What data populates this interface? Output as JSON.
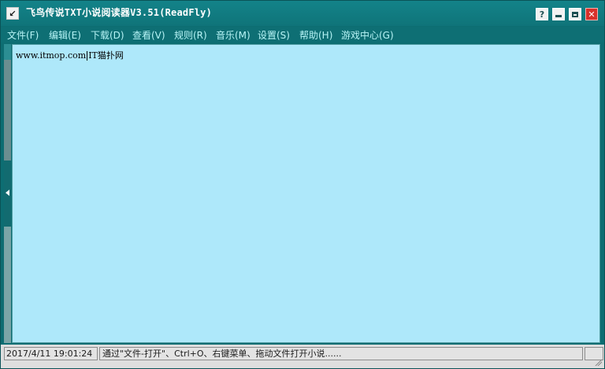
{
  "window": {
    "title": "飞鸟传说TXT小说阅读器V3.51(ReadFly)",
    "app_icon": "↙",
    "buttons": {
      "help": "?",
      "close": "✕"
    }
  },
  "menu": {
    "items": [
      {
        "label": "文件(F)"
      },
      {
        "label": "编辑(E)"
      },
      {
        "label": "下载(D)"
      },
      {
        "label": "查看(V)"
      },
      {
        "label": "规则(R)"
      },
      {
        "label": "音乐(M)"
      },
      {
        "label": "设置(S)"
      },
      {
        "label": "帮助(H)"
      },
      {
        "label": "游戏中心(G)"
      }
    ]
  },
  "reader": {
    "text_before": "www.itmop.com",
    "text_after": "IT猫扑网"
  },
  "status": {
    "time": "2017/4/11 19:01:24",
    "message": "通过\"文件-打开\"、Ctrl+O、右键菜单、拖动文件打开小说......"
  },
  "colors": {
    "titlebar": "#138389",
    "menu_text": "#b7f4f6",
    "reader_bg": "#aee8fa",
    "close_button": "#d8312b"
  }
}
